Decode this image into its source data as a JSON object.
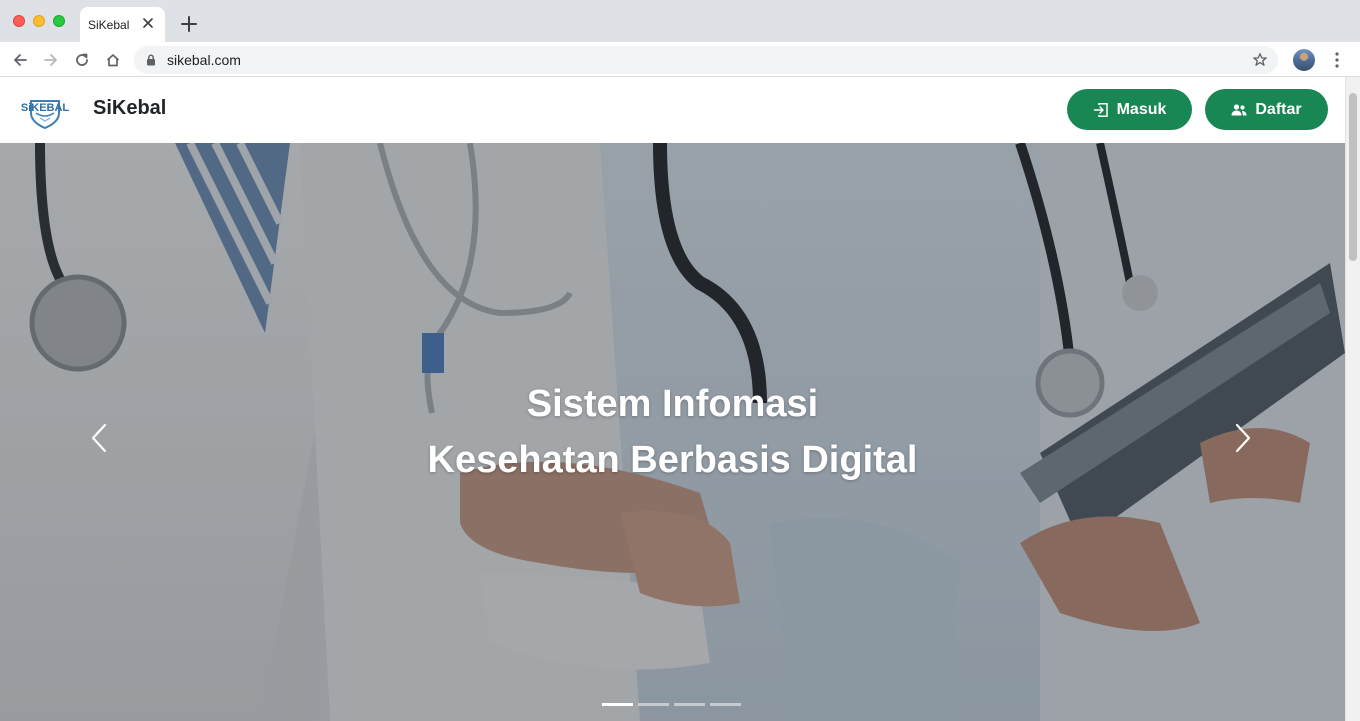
{
  "browser": {
    "tab_title": "SiKebal",
    "url": "sikebal.com"
  },
  "site": {
    "logo_text": "SiKEBAL",
    "brand": "SiKebal",
    "login_label": "Masuk",
    "register_label": "Daftar",
    "accent_color": "#198754"
  },
  "hero": {
    "line1": "Sistem Infomasi",
    "line2": "Kesehatan Berbasis Digital",
    "slide_count": 4,
    "active_slide": 1
  },
  "icons": {
    "back": "arrow-left-icon",
    "forward": "arrow-right-icon",
    "reload": "reload-icon",
    "home": "home-icon",
    "lock": "lock-icon",
    "star": "star-icon",
    "login": "login-icon",
    "register": "users-icon",
    "prev": "chevron-left-icon",
    "next": "chevron-right-icon"
  }
}
